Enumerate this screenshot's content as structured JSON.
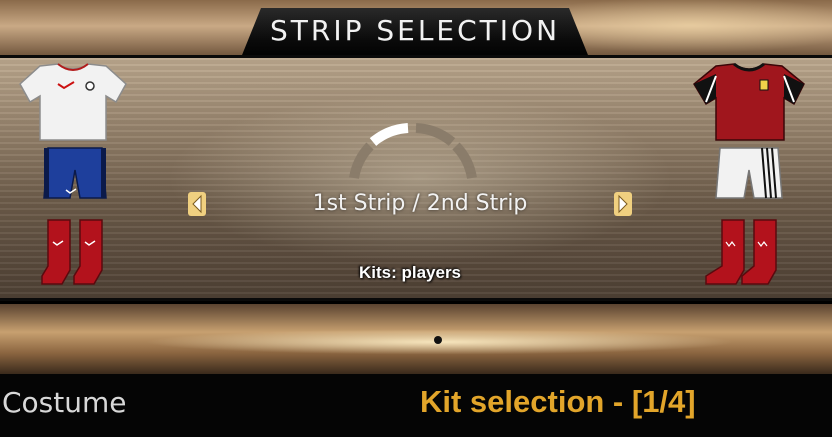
{
  "title": "STRIP SELECTION",
  "strip_selector": {
    "label": "1st Strip / 2nd Strip",
    "prev_icon": "triangle-left-icon",
    "next_icon": "triangle-right-icon"
  },
  "kits_info": "Kits: players",
  "left_kit": {
    "shirt_color": "#f2f2f2",
    "shorts_color": "#1e3f9c",
    "socks_color": "#b3121c"
  },
  "right_kit": {
    "shirt_color": "#a0161d",
    "shorts_color": "#f2f2f2",
    "socks_color": "#b3121c"
  },
  "footer": {
    "left_label": "Costume",
    "right_label": "Kit selection - [1/4]"
  },
  "colors": {
    "accent": "#e2a52a"
  }
}
